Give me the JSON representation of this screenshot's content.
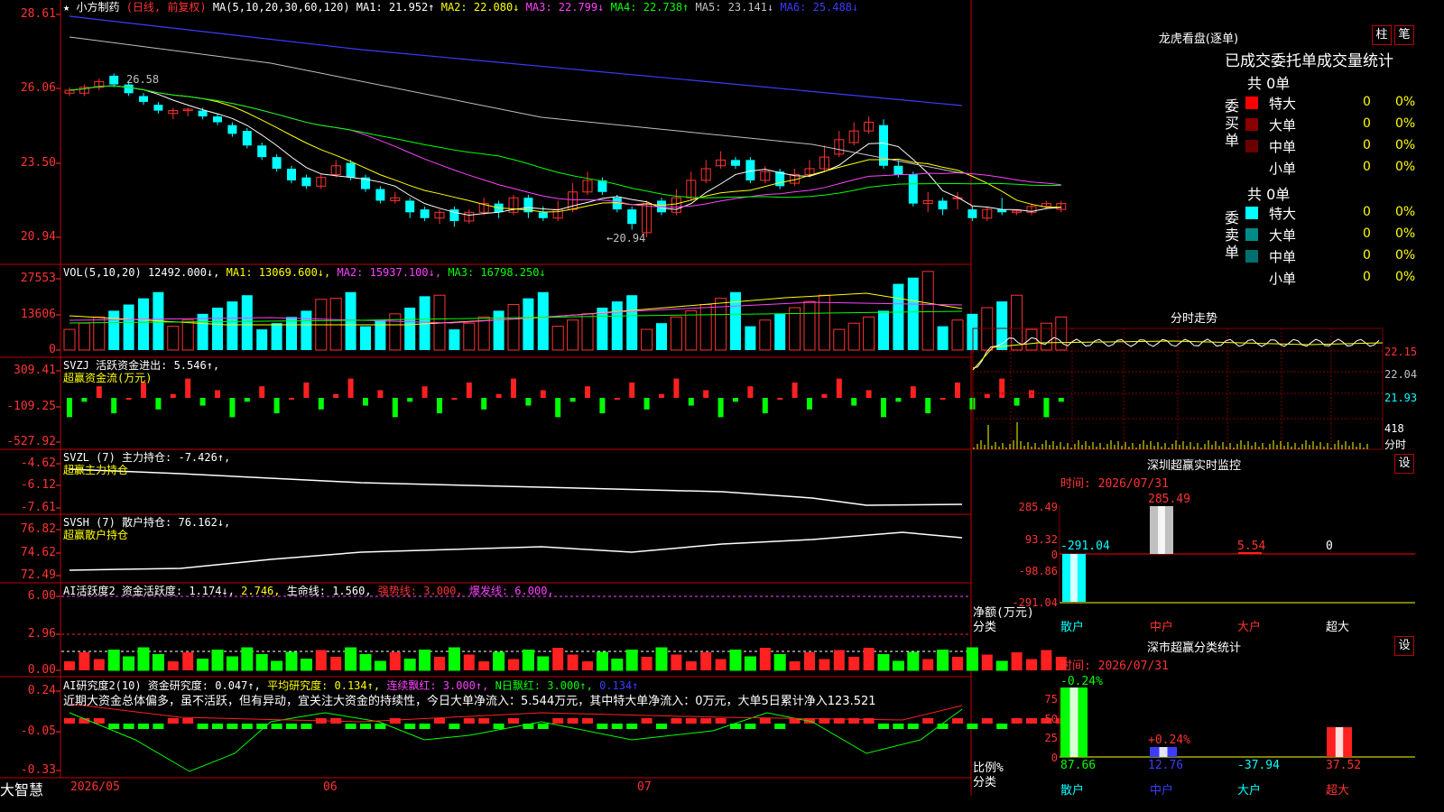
{
  "header": {
    "stock_name": "★ 小方制药",
    "period": "(日线, 前复权)",
    "ma_label": "MA(5,10,20,30,60,120)",
    "ma": [
      {
        "label": "MA1: 21.952↑",
        "color": "#ffffff"
      },
      {
        "label": "MA2: 22.080↓",
        "color": "#ffff00"
      },
      {
        "label": "MA3: 22.799↓",
        "color": "#ff40ff"
      },
      {
        "label": "MA4: 22.738↑",
        "color": "#00ff00"
      },
      {
        "label": "MA5: 23.141↓",
        "color": "#c0c0c0"
      },
      {
        "label": "MA6: 25.488↓",
        "color": "#3c3cff"
      }
    ]
  },
  "price_panel": {
    "yaxis": [
      "28.61",
      "26.06",
      "23.50",
      "20.94"
    ],
    "high_note": "26.58",
    "low_note": "←20.94"
  },
  "vol_panel": {
    "title": "VOL(5,10,20)",
    "value": "12492.000↓,",
    "ma1": "MA1: 13069.600↓,",
    "ma2": "MA2: 15937.100↓,",
    "ma3": "MA3: 16798.250↓",
    "yaxis": [
      "27553",
      "13606",
      "0"
    ]
  },
  "svzj_panel": {
    "title": "SVZJ  活跃资金进出: 5.546↑,",
    "sub": "超赢资金流(万元)",
    "yaxis": [
      "309.41",
      "-109.25",
      "-527.92"
    ]
  },
  "svzl_panel": {
    "title": "SVZL (7) 主力持仓: -7.426↑,",
    "sub": "超赢主力持仓",
    "yaxis": [
      "-4.62",
      "-6.12",
      "-7.61"
    ]
  },
  "svsh_panel": {
    "title": "SVSH (7) 散户持仓: 76.162↓,",
    "sub": "超赢散户持仓",
    "yaxis": [
      "76.82",
      "74.62",
      "72.49"
    ]
  },
  "ai1_panel": {
    "title": "AI活跃度2 资金活跃度: 1.174↓,",
    "v2": "2.746,",
    "life": "生命线: 1.560,",
    "strong": "强势线: 3.000,",
    "burst": "爆发线: 6.000,",
    "yaxis": [
      "6.00",
      "2.96",
      "0.00"
    ]
  },
  "ai2_panel": {
    "title": "AI研究度2(10) 资金研究度: 0.047↑,",
    "avg": "平均研究度: 0.134↑,",
    "cont": "连续飘红: 3.000↑,",
    "nday": "N日飘红: 3.000↑,",
    "last": "0.134↑",
    "comment": "近期大资金总体偏多，虽不活跃，但有异动，宜关注大资金的持续性，今日大单净流入：5.544万元，其中特大单净流入：0万元，大单5日累计净入123.521",
    "yaxis": [
      "0.24",
      "-0.05",
      "-0.33"
    ]
  },
  "footer": {
    "brand": "大智慧",
    "dates": [
      "2026/05",
      "06",
      "07"
    ]
  },
  "right": {
    "lhb_title": "龙虎看盘(逐单)",
    "btn_zhu": "柱",
    "btn_bi": "笔",
    "tabs": "已成交委托单成交量统计",
    "buy_label": "委买单",
    "sell_label": "委卖单",
    "buy_total": "共 0单",
    "sell_total": "共 0单",
    "buy_rows": [
      {
        "name": "特大",
        "value": "0",
        "pct": "0%",
        "color": "#ff0000"
      },
      {
        "name": "大单",
        "value": "0",
        "pct": "0%",
        "color": "#8b0000"
      },
      {
        "name": "中单",
        "value": "0",
        "pct": "0%",
        "color": "#6b0000"
      },
      {
        "name": "小单",
        "value": "0",
        "pct": "0%",
        "color": ""
      }
    ],
    "sell_rows": [
      {
        "name": "特大",
        "value": "0",
        "pct": "0%",
        "color": "#00ffff"
      },
      {
        "name": "大单",
        "value": "0",
        "pct": "0%",
        "color": "#008b8b"
      },
      {
        "name": "中单",
        "value": "0",
        "pct": "0%",
        "color": "#006f6f"
      },
      {
        "name": "小单",
        "value": "0",
        "pct": "0%",
        "color": ""
      }
    ],
    "intraday_title": "分时走势",
    "intraday_yaxis": [
      "22.15",
      "22.04",
      "21.93"
    ],
    "intraday_vol": "418",
    "intraday_vol_unit": "分时",
    "monitor_title": "深圳超赢实时监控",
    "monitor_btn": "设",
    "monitor_time": "时间: 2026/07/31",
    "monitor_yaxis": [
      "285.49",
      "93.32",
      "0",
      "-98.86",
      "-291.04"
    ],
    "monitor_yaxis_unit": "净额(万元)",
    "monitor_xaxis_unit": "分类",
    "monitor_values": [
      "-291.04",
      "285.49",
      "5.54",
      "0"
    ],
    "monitor_cats": [
      "散户",
      "中户",
      "大户",
      "超大"
    ],
    "stat_title": "深市超赢分类统计",
    "stat_btn": "设",
    "stat_time": "时间: 2026/07/31",
    "stat_yaxis": [
      "75",
      "50",
      "25",
      "0"
    ],
    "stat_yaxis_unit": "比例%",
    "stat_xaxis_unit": "分类",
    "stat_bar_labels": [
      "-0.24%",
      "+0.24%"
    ],
    "stat_values": [
      "87.66",
      "12.76",
      "-37.94",
      "37.52"
    ],
    "stat_cats": [
      "散户",
      "中户",
      "大户",
      "超大"
    ]
  },
  "chart_data": {
    "type": "candlestick",
    "candles": [
      [
        25.9,
        26.0,
        25.8,
        26.1
      ],
      [
        25.9,
        26.1,
        25.8,
        26.2
      ],
      [
        26.1,
        26.3,
        26.0,
        26.4
      ],
      [
        26.5,
        26.2,
        26.1,
        26.58
      ],
      [
        26.2,
        25.9,
        25.8,
        26.3
      ],
      [
        25.8,
        25.6,
        25.5,
        25.9
      ],
      [
        25.5,
        25.3,
        25.2,
        25.6
      ],
      [
        25.2,
        25.3,
        25.0,
        25.4
      ],
      [
        25.3,
        25.35,
        25.1,
        25.4
      ],
      [
        25.3,
        25.1,
        25.0,
        25.4
      ],
      [
        25.1,
        24.9,
        24.8,
        25.2
      ],
      [
        24.8,
        24.5,
        24.4,
        24.9
      ],
      [
        24.6,
        24.1,
        24.0,
        24.7
      ],
      [
        24.1,
        23.7,
        23.6,
        24.2
      ],
      [
        23.7,
        23.3,
        23.2,
        23.8
      ],
      [
        23.3,
        22.9,
        22.8,
        23.4
      ],
      [
        23.0,
        22.7,
        22.6,
        23.1
      ],
      [
        22.7,
        23.0,
        22.6,
        23.1
      ],
      [
        23.1,
        23.4,
        23.0,
        23.6
      ],
      [
        23.5,
        23.0,
        22.9,
        23.6
      ],
      [
        23.0,
        22.6,
        22.5,
        23.1
      ],
      [
        22.6,
        22.2,
        22.1,
        22.7
      ],
      [
        22.2,
        22.3,
        22.1,
        22.5
      ],
      [
        22.2,
        21.8,
        21.6,
        22.3
      ],
      [
        21.9,
        21.6,
        21.5,
        22.0
      ],
      [
        21.6,
        21.8,
        21.4,
        21.9
      ],
      [
        21.9,
        21.5,
        21.3,
        22.0
      ],
      [
        21.5,
        21.8,
        21.4,
        21.9
      ],
      [
        21.8,
        22.1,
        21.7,
        22.3
      ],
      [
        22.1,
        21.8,
        21.6,
        22.2
      ],
      [
        21.8,
        22.3,
        21.7,
        22.4
      ],
      [
        22.3,
        21.8,
        21.6,
        22.4
      ],
      [
        21.8,
        21.6,
        21.5,
        22.0
      ],
      [
        21.6,
        21.9,
        21.5,
        22.2
      ],
      [
        21.9,
        22.5,
        21.8,
        22.8
      ],
      [
        22.5,
        22.9,
        22.4,
        23.2
      ],
      [
        22.9,
        22.5,
        22.4,
        23.0
      ],
      [
        22.3,
        21.9,
        21.8,
        22.4
      ],
      [
        21.9,
        21.4,
        21.2,
        22.0
      ],
      [
        21.1,
        22.1,
        20.94,
        22.2
      ],
      [
        22.2,
        21.8,
        21.7,
        22.3
      ],
      [
        21.8,
        22.3,
        21.7,
        22.6
      ],
      [
        22.3,
        22.9,
        22.2,
        23.2
      ],
      [
        22.9,
        23.3,
        22.8,
        23.6
      ],
      [
        23.4,
        23.6,
        23.3,
        23.9
      ],
      [
        23.6,
        23.4,
        23.3,
        23.7
      ],
      [
        23.6,
        22.9,
        22.8,
        23.7
      ],
      [
        22.9,
        23.2,
        22.8,
        23.4
      ],
      [
        23.2,
        22.7,
        22.6,
        23.3
      ],
      [
        22.8,
        23.1,
        22.7,
        23.3
      ],
      [
        23.1,
        23.3,
        23.0,
        23.6
      ],
      [
        23.3,
        23.7,
        23.2,
        24.1
      ],
      [
        23.8,
        24.3,
        23.7,
        24.6
      ],
      [
        24.2,
        24.6,
        24.1,
        24.9
      ],
      [
        24.6,
        24.9,
        24.5,
        25.1
      ],
      [
        24.8,
        23.4,
        23.3,
        25.0
      ],
      [
        23.4,
        23.1,
        23.0,
        23.6
      ],
      [
        23.1,
        22.1,
        22.0,
        23.2
      ],
      [
        22.1,
        22.2,
        21.8,
        22.5
      ],
      [
        22.2,
        21.9,
        21.7,
        22.3
      ],
      [
        22.3,
        22.3,
        21.9,
        22.5
      ],
      [
        21.9,
        21.6,
        21.5,
        22.0
      ],
      [
        21.6,
        21.9,
        21.5,
        22.0
      ],
      [
        21.9,
        21.8,
        21.7,
        22.3
      ],
      [
        21.8,
        21.85,
        21.7,
        21.9
      ],
      [
        21.8,
        22.0,
        21.7,
        22.1
      ],
      [
        22.0,
        22.1,
        21.9,
        22.2
      ],
      [
        21.9,
        22.1,
        21.8,
        22.2
      ]
    ]
  }
}
